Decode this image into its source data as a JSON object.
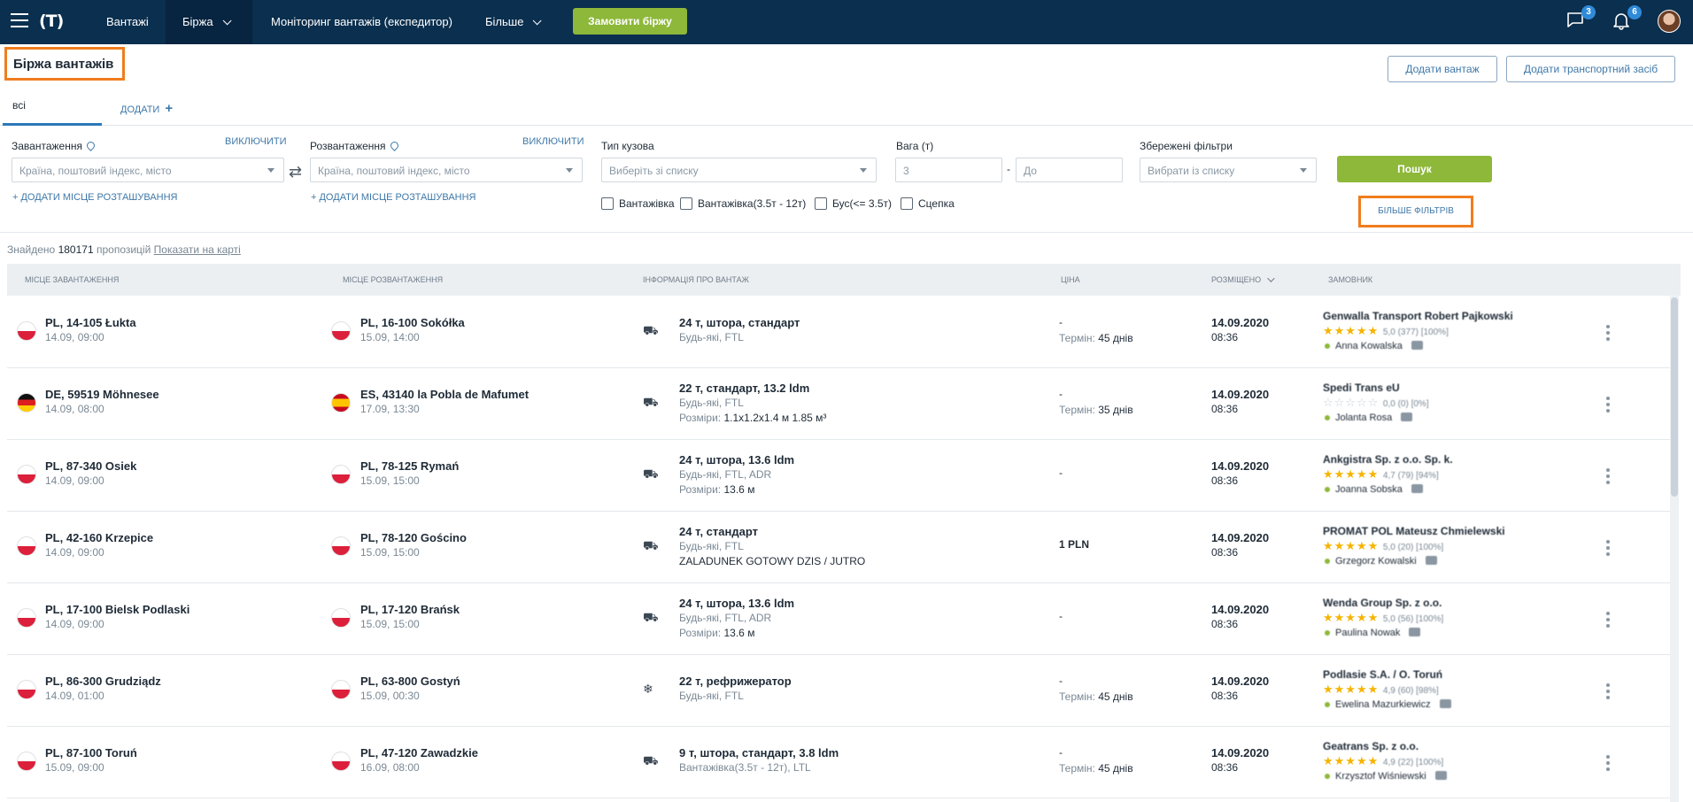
{
  "nav": {
    "items": [
      {
        "label": "Вантажі"
      },
      {
        "label": "Біржа"
      },
      {
        "label": "Моніторинг вантажів (експедитор)"
      },
      {
        "label": "Більше"
      }
    ],
    "order_button": "Замовити біржу",
    "messages_badge": "3",
    "notifications_badge": "6"
  },
  "header": {
    "title": "Біржа вантажів",
    "add_cargo": "Додати вантаж",
    "add_vehicle": "Додати транспортний засіб"
  },
  "tabs": {
    "all": "всі",
    "add": "ДОДАТИ"
  },
  "filters": {
    "loading_label": "Завантаження",
    "loading_toggle": "ВИКЛЮЧИТИ",
    "loading_placeholder": "Країна, поштовий індекс, місто",
    "loading_add": "+ ДОДАТИ МІСЦЕ РОЗТАШУВАННЯ",
    "unloading_label": "Розвантаження",
    "unloading_toggle": "ВИКЛЮЧИТИ",
    "unloading_placeholder": "Країна, поштовий індекс, місто",
    "unloading_add": "+ ДОДАТИ МІСЦЕ РОЗТАШУВАННЯ",
    "body_label": "Тип кузова",
    "body_placeholder": "Виберіть зі списку",
    "weight_label": "Вага (т)",
    "weight_from": "3",
    "weight_to": "До",
    "saved_label": "Збережені фільтри",
    "saved_placeholder": "Вибрати із списку",
    "search": "Пошук",
    "more": "БІЛЬШЕ ФІЛЬТРІВ",
    "checkboxes": [
      "Вантажівка",
      "Вантажівка(3.5т - 12т)",
      "Бус(<= 3.5т)",
      "Сцепка"
    ]
  },
  "results": {
    "prefix": "Знайдено",
    "count": "180171",
    "suffix": "пропозицій",
    "map_link": "Показати на карті"
  },
  "columns": {
    "loading": "МІСЦЕ ЗАВАНТАЖЕННЯ",
    "unloading": "МІСЦЕ РОЗВАНТАЖЕННЯ",
    "info": "ІНФОРМАЦІЯ ПРО ВАНТАЖ",
    "price": "ЦІНА",
    "posted": "РОЗМІЩЕНО",
    "customer": "ЗАМОВНИК"
  },
  "rows": [
    {
      "from_flag": "pl",
      "from": "PL, 14-105 Łukta",
      "from_date": "14.09, 09:00",
      "to_flag": "pl",
      "to": "PL, 16-100 Sokółka",
      "to_date": "15.09, 14:00",
      "icon": "truck-curtain-icon",
      "cargo": "24 т, штора, стандарт",
      "details": "Будь-які, FTL",
      "extra_label": "",
      "extra": "",
      "price": "-",
      "term_label": "Термін:",
      "term": "45 днів",
      "posted_date": "14.09.2020",
      "posted_time": "08:36",
      "customer": "Genwalla Transport Robert Pajkowski",
      "rating": "★★★★★",
      "rating_text": "5,0 (377) [100%]",
      "contact": "Anna Kowalska"
    },
    {
      "from_flag": "de",
      "from": "DE, 59519 Möhnesee",
      "from_date": "14.09, 08:00",
      "to_flag": "es",
      "to": "ES, 43140 la Pobla de Mafumet",
      "to_date": "17.09, 13:30",
      "icon": "truck-box-icon",
      "cargo": "22 т, стандарт, 13.2 ldm",
      "details": "Будь-які, FTL",
      "extra_label": "Розміри:",
      "extra": "1.1x1.2x1.4 м 1.85 м³",
      "price": "-",
      "term_label": "Термін:",
      "term": "35 днів",
      "posted_date": "14.09.2020",
      "posted_time": "08:36",
      "customer": "Spedi Trans eU",
      "rating": "☆☆☆☆☆",
      "rating_text": "0,0 (0) [0%]",
      "contact": "Jolanta Rosa"
    },
    {
      "from_flag": "pl",
      "from": "PL, 87-340 Osiek",
      "from_date": "14.09, 09:00",
      "to_flag": "pl",
      "to": "PL, 78-125 Rymań",
      "to_date": "15.09, 15:00",
      "icon": "truck-curtain-icon",
      "cargo": "24 т, штора, 13.6 ldm",
      "details": "Будь-які, FTL, ADR",
      "extra_label": "Розміри:",
      "extra": "13.6 м",
      "price": "-",
      "term_label": "",
      "term": "",
      "posted_date": "14.09.2020",
      "posted_time": "08:36",
      "customer": "Ankgistra Sp. z o.o. Sp. k.",
      "rating": "★★★★★",
      "rating_text": "4,7 (79) [94%]",
      "contact": "Joanna Sobska"
    },
    {
      "from_flag": "pl",
      "from": "PL, 42-160 Krzepice",
      "from_date": "14.09, 09:00",
      "to_flag": "pl",
      "to": "PL, 78-120 Gościno",
      "to_date": "15.09, 15:00",
      "icon": "truck-box-icon",
      "cargo": "24 т, стандарт",
      "details": "Будь-які, FTL",
      "extra_label": "",
      "extra": "ZALADUNEK GOTOWY DZIS / JUTRO",
      "price": "1 PLN",
      "term_label": "",
      "term": "",
      "posted_date": "14.09.2020",
      "posted_time": "08:36",
      "customer": "PROMAT POL Mateusz Chmielewski",
      "rating": "★★★★★",
      "rating_text": "5,0 (20) [100%]",
      "contact": "Grzegorz Kowalski"
    },
    {
      "from_flag": "pl",
      "from": "PL, 17-100 Bielsk Podlaski",
      "from_date": "14.09, 09:00",
      "to_flag": "pl",
      "to": "PL, 17-120 Brańsk",
      "to_date": "15.09, 15:00",
      "icon": "truck-curtain-icon",
      "cargo": "24 т, штора, 13.6 ldm",
      "details": "Будь-які, FTL, ADR",
      "extra_label": "Розміри:",
      "extra": "13.6 м",
      "price": "-",
      "term_label": "",
      "term": "",
      "posted_date": "14.09.2020",
      "posted_time": "08:36",
      "customer": "Wenda Group Sp. z o.o.",
      "rating": "★★★★★",
      "rating_text": "5,0 (56) [100%]",
      "contact": "Paulina Nowak"
    },
    {
      "from_flag": "pl",
      "from": "PL, 86-300 Grudziądz",
      "from_date": "14.09, 01:00",
      "to_flag": "pl",
      "to": "PL, 63-800 Gostyń",
      "to_date": "15.09, 00:30",
      "icon": "snowflake-icon",
      "cargo": "22 т, рефрижератор",
      "details": "Будь-які, FTL",
      "extra_label": "",
      "extra": "",
      "price": "-",
      "term_label": "Термін:",
      "term": "45 днів",
      "posted_date": "14.09.2020",
      "posted_time": "08:36",
      "customer": "Podlasie S.A. / O. Toruń",
      "rating": "★★★★★",
      "rating_text": "4,9 (60) [98%]",
      "contact": "Ewelina Mazurkiewicz"
    },
    {
      "from_flag": "pl",
      "from": "PL, 87-100 Toruń",
      "from_date": "15.09, 09:00",
      "to_flag": "pl",
      "to": "PL, 47-120 Zawadzkie",
      "to_date": "16.09, 08:00",
      "icon": "truck-curtain-icon",
      "cargo": "9 т, штора, стандарт, 3.8 ldm",
      "details": "Вантажівка(3.5т - 12т), LTL",
      "extra_label": "",
      "extra": "",
      "price": "-",
      "term_label": "Термін:",
      "term": "45 днів",
      "posted_date": "14.09.2020",
      "posted_time": "08:36",
      "customer": "Geatrans Sp. z o.o.",
      "rating": "★★★★★",
      "rating_text": "4,9 (22) [100%]",
      "contact": "Krzysztof Wiśniewski"
    }
  ]
}
